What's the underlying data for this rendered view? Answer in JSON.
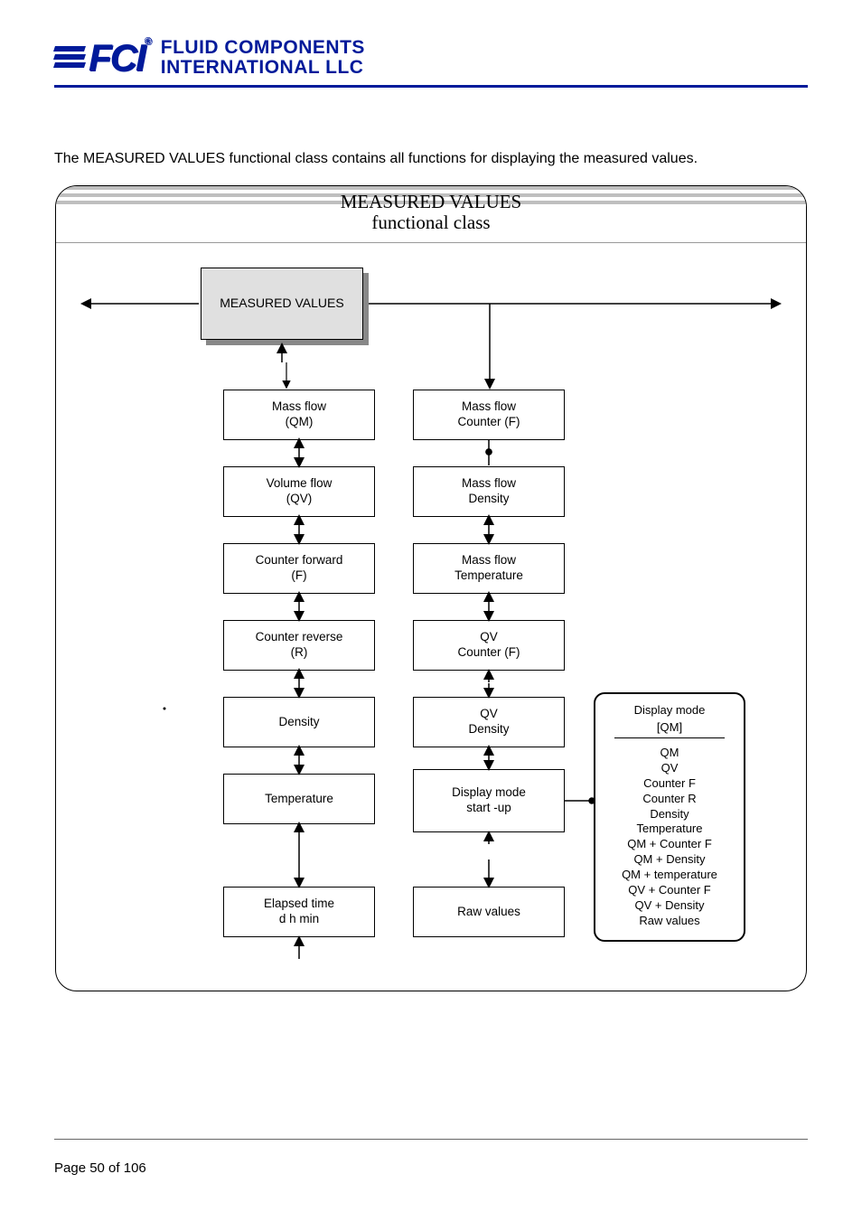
{
  "logo": {
    "abbr": "FCI",
    "line1": "FLUID COMPONENTS",
    "line2": "INTERNATIONAL LLC",
    "reg": "®"
  },
  "intro": "The MEASURED VALUES functional class contains all functions for displaying the measured values.",
  "diagram": {
    "title": "MEASURED VALUES",
    "subtitle": "functional class",
    "root": "MEASURED VALUES",
    "col1": [
      {
        "l1": "Mass flow",
        "l2": "(QM)"
      },
      {
        "l1": "Volume flow",
        "l2": "(QV)"
      },
      {
        "l1": "Counter forward",
        "l2": "(F)"
      },
      {
        "l1": "Counter reverse",
        "l2": "(R)"
      },
      {
        "l1": "Density",
        "l2": ""
      },
      {
        "l1": "Temperature",
        "l2": ""
      },
      {
        "l1": "Elapsed  time",
        "l2": "d h min"
      }
    ],
    "col2": [
      {
        "l1": "Mass flow",
        "l2": "Counter (F)"
      },
      {
        "l1": "Mass flow",
        "l2": "Density"
      },
      {
        "l1": "Mass flow",
        "l2": "Temperature"
      },
      {
        "l1": "QV",
        "l2": "Counter (F)"
      },
      {
        "l1": "QV",
        "l2": "Density"
      },
      {
        "l1": "Display mode",
        "l2": "start -up"
      },
      {
        "l1": "Raw  values",
        "l2": ""
      }
    ],
    "options": {
      "head1": "Display mode",
      "head2": "[QM]",
      "items": [
        "QM",
        "QV",
        "Counter F",
        "Counter R",
        "Density",
        "Temperature",
        "QM + Counter F",
        "QM + Density",
        "QM + temperature",
        "QV + Counter F",
        "QV + Density",
        "Raw values"
      ]
    }
  },
  "footer": "Page 50 of 106"
}
